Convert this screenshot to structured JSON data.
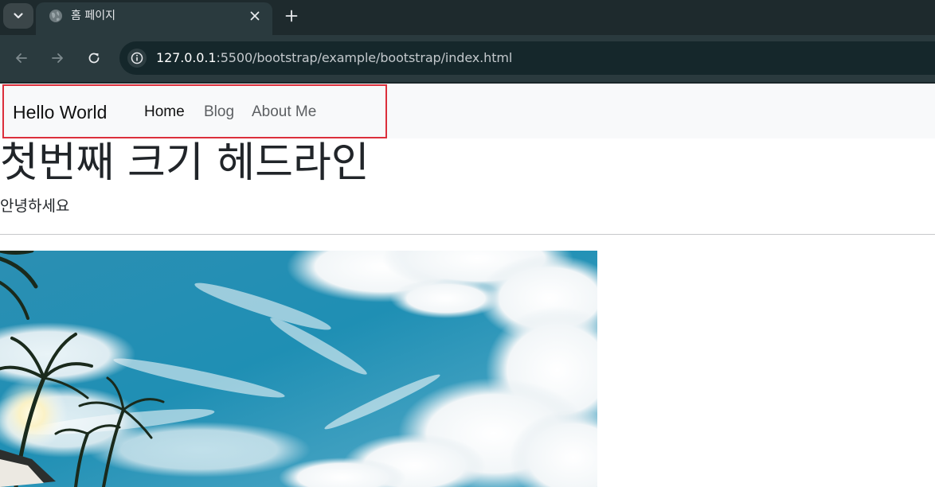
{
  "browser": {
    "tab": {
      "title": "홈 페이지",
      "favicon": "globe-icon"
    },
    "url": {
      "host": "127.0.0.1",
      "rest": ":5500/bootstrap/example/bootstrap/index.html"
    },
    "colors": {
      "tabstrip": "#1e2a2d",
      "toolbar": "#2a3a3e",
      "omnibox": "#15272b"
    }
  },
  "navbar": {
    "brand": "Hello World",
    "links": [
      {
        "label": "Home",
        "active": true
      },
      {
        "label": "Blog",
        "active": false
      },
      {
        "label": "About Me",
        "active": false
      }
    ],
    "highlight_color": "#dc2f3b"
  },
  "content": {
    "headline": "첫번째 크기 헤드라인",
    "greeting": "안녕하세요"
  },
  "hero_image": {
    "subject": "palm trees under a blue sky with clouds"
  }
}
